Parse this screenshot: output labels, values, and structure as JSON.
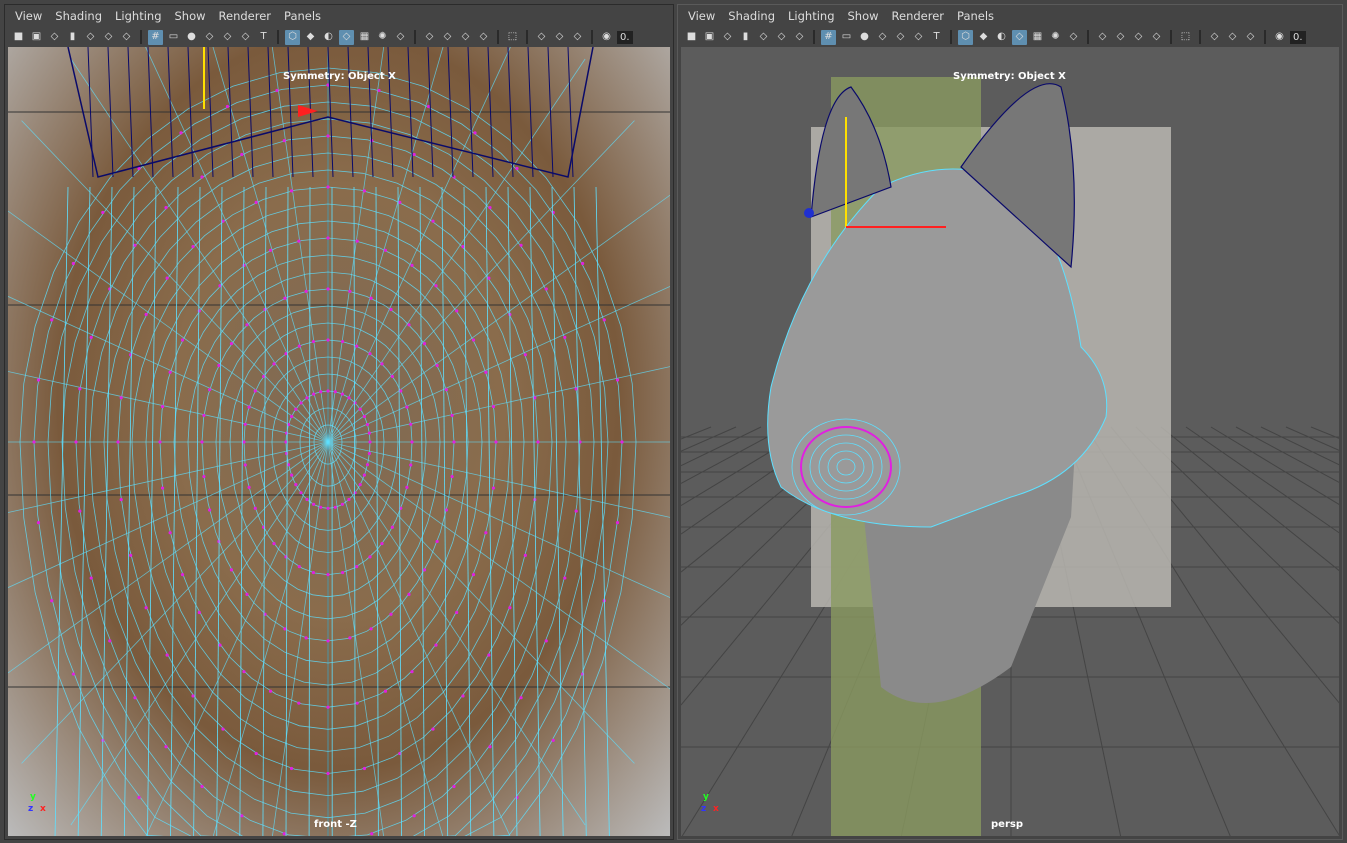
{
  "menu": [
    "View",
    "Shading",
    "Lighting",
    "Show",
    "Renderer",
    "Panels"
  ],
  "toolbar_icons": [
    "camera-icon",
    "lock-camera-icon",
    "camera-attributes-icon",
    "bookmark-icon",
    "image-plane-icon",
    "2d-pan-zoom-icon",
    "grease-pencil-icon",
    "|",
    "grid-icon",
    "film-gate-icon",
    "resolution-gate-icon",
    "gate-mask-icon",
    "field-chart-icon",
    "safe-action-icon",
    "safe-title-icon",
    "|",
    "wireframe-icon",
    "smooth-shade-icon",
    "default-material-icon",
    "wireframe-on-shaded-icon",
    "textured-icon",
    "use-all-lights-icon",
    "shadows-icon",
    "|",
    "screen-space-ao-icon",
    "motion-blur-icon",
    "anti-aliasing-icon",
    "depth-of-field-icon",
    "|",
    "isolate-select-icon",
    "|",
    "xray-icon",
    "xray-active-components-icon",
    "xray-joints-icon",
    "|",
    "exposure-icon"
  ],
  "toolbar_active": [
    "grid-icon",
    "wireframe-icon",
    "wireframe-on-shaded-icon"
  ],
  "toolbar_value": "0.",
  "viewports": [
    {
      "symmetry": "Symmetry: Object X",
      "camera": "front -Z",
      "axes": {
        "y": "y",
        "x": "x",
        "z": "z"
      }
    },
    {
      "symmetry": "Symmetry: Object X",
      "camera": "persp",
      "axes": {
        "y": "y",
        "x": "x",
        "z": "z"
      }
    }
  ],
  "colors": {
    "wire": "#5ee0ff",
    "vertex": "#e020e0",
    "selected_wire": "#0a0a6a",
    "axis_x": "#ff2020",
    "axis_y": "#ffe000",
    "axis_z": "#2030d0"
  }
}
